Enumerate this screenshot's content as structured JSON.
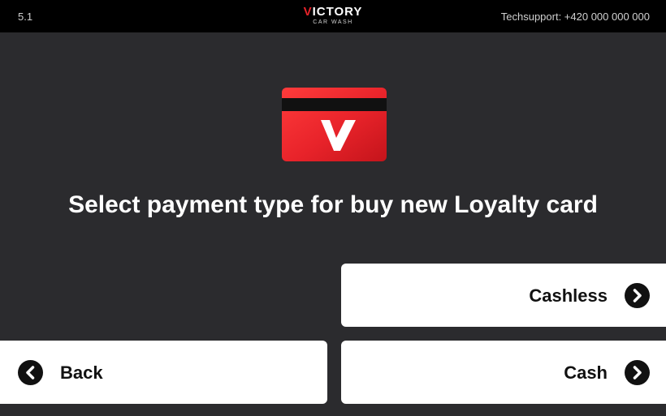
{
  "header": {
    "version": "5.1",
    "brand_name_first": "V",
    "brand_name_rest": "ICTORY",
    "brand_sub": "CAR WASH",
    "support": "Techsupport: +420 000 000 000"
  },
  "main": {
    "icon": "loyalty-card-icon",
    "title": "Select payment type for buy new Loyalty card"
  },
  "buttons": {
    "cashless_label": "Cashless",
    "cash_label": "Cash",
    "back_label": "Back"
  },
  "colors": {
    "background": "#2b2b2e",
    "topbar": "#000000",
    "accent": "#e8232a",
    "button": "#ffffff"
  }
}
